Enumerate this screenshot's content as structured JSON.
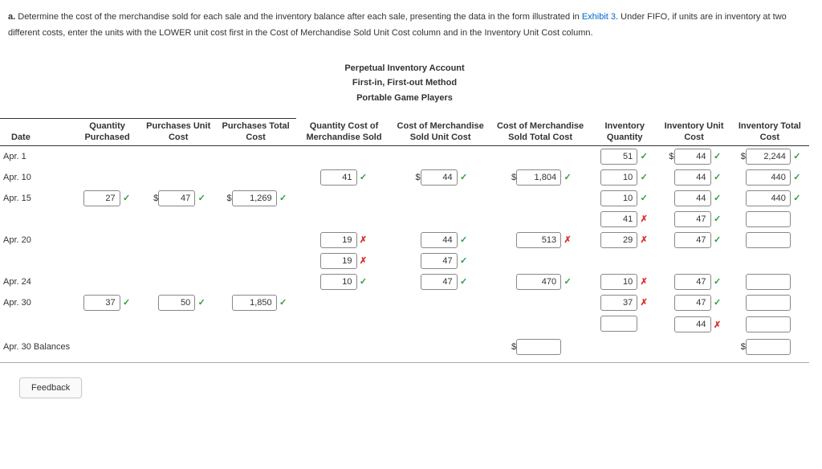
{
  "instr": {
    "label": "a.",
    "text1": " Determine the cost of the merchandise sold for each sale and the inventory balance after each sale, presenting the data in the form illustrated in ",
    "link": "Exhibit 3",
    "text2": ". Under FIFO, if units are in inventory at two different costs, enter the units with the LOWER unit cost first in the Cost of Merchandise Sold Unit Cost column and in the Inventory Unit Cost column."
  },
  "title": {
    "l1": "Perpetual Inventory Account",
    "l2": "First-in, First-out Method",
    "l3": "Portable Game Players"
  },
  "headers": {
    "date": "Date",
    "qp": "Quantity Purchased",
    "puc": "Purchases Unit Cost",
    "ptc": "Purchases Total Cost",
    "qcms": "Quantity Cost of Merchandise Sold",
    "cmsuc": "Cost of Merchandise Sold Unit Cost",
    "cmstc": "Cost of Merchandise Sold Total Cost",
    "iq": "Inventory Quantity",
    "iuc": "Inventory Unit Cost",
    "itc": "Inventory Total Cost"
  },
  "dates": {
    "r1": "Apr. 1",
    "r2": "Apr. 10",
    "r3": "Apr. 15",
    "r4": "",
    "r5": "Apr. 20",
    "r6": "",
    "r7": "Apr. 24",
    "r8": "Apr. 30",
    "r9": "",
    "r10": "Apr. 30  Balances"
  },
  "chart_data": {
    "type": "table",
    "columns": [
      "Date",
      "Quantity Purchased",
      "Purchases Unit Cost",
      "Purchases Total Cost",
      "Quantity COGS",
      "COGS Unit Cost",
      "COGS Total Cost",
      "Inventory Quantity",
      "Inventory Unit Cost",
      "Inventory Total Cost"
    ],
    "rows": [
      {
        "date": "Apr. 1",
        "iq": {
          "v": "51",
          "m": "ok"
        },
        "iuc": {
          "v": "44",
          "m": "ok",
          "d": true
        },
        "itc": {
          "v": "2,244",
          "m": "ok",
          "d": true
        }
      },
      {
        "date": "Apr. 10",
        "qs": {
          "v": "41",
          "m": "ok"
        },
        "suc": {
          "v": "44",
          "m": "ok",
          "d": true
        },
        "stc": {
          "v": "1,804",
          "m": "ok",
          "d": true
        },
        "iq": {
          "v": "10",
          "m": "ok"
        },
        "iuc": {
          "v": "44",
          "m": "ok"
        },
        "itc": {
          "v": "440",
          "m": "ok"
        }
      },
      {
        "date": "Apr. 15",
        "qp": {
          "v": "27",
          "m": "ok"
        },
        "puc": {
          "v": "47",
          "m": "ok",
          "d": true
        },
        "ptc": {
          "v": "1,269",
          "m": "ok",
          "d": true
        },
        "iq": {
          "v": "10",
          "m": "ok"
        },
        "iuc": {
          "v": "44",
          "m": "ok"
        },
        "itc": {
          "v": "440",
          "m": "ok"
        }
      },
      {
        "date": "",
        "iq": {
          "v": "41",
          "m": "bad"
        },
        "iuc": {
          "v": "47",
          "m": "ok"
        },
        "itc": {
          "v": "",
          "m": ""
        }
      },
      {
        "date": "Apr. 20",
        "qs": {
          "v": "19",
          "m": "bad"
        },
        "suc": {
          "v": "44",
          "m": "ok"
        },
        "stc": {
          "v": "513",
          "m": "bad"
        },
        "iq": {
          "v": "29",
          "m": "bad"
        },
        "iuc": {
          "v": "47",
          "m": "ok"
        },
        "itc": {
          "v": "",
          "m": ""
        }
      },
      {
        "date": "",
        "qs": {
          "v": "19",
          "m": "bad"
        },
        "suc": {
          "v": "47",
          "m": "ok"
        }
      },
      {
        "date": "Apr. 24",
        "qs": {
          "v": "10",
          "m": "ok"
        },
        "suc": {
          "v": "47",
          "m": "ok"
        },
        "stc": {
          "v": "470",
          "m": "ok"
        },
        "iq": {
          "v": "10",
          "m": "bad"
        },
        "iuc": {
          "v": "47",
          "m": "ok"
        },
        "itc": {
          "v": "",
          "m": ""
        }
      },
      {
        "date": "Apr. 30",
        "qp": {
          "v": "37",
          "m": "ok"
        },
        "puc": {
          "v": "50",
          "m": "ok"
        },
        "ptc": {
          "v": "1,850",
          "m": "ok"
        },
        "iq": {
          "v": "37",
          "m": "bad"
        },
        "iuc": {
          "v": "47",
          "m": "ok"
        },
        "itc": {
          "v": "",
          "m": ""
        }
      },
      {
        "date": "",
        "iq": {
          "v": "",
          "m": ""
        },
        "iuc": {
          "v": "44",
          "m": "bad"
        },
        "itc": {
          "v": "",
          "m": ""
        }
      },
      {
        "date": "Apr. 30  Balances",
        "stc": {
          "v": "",
          "m": "",
          "d": true
        },
        "itc": {
          "v": "",
          "m": "",
          "d": true
        }
      }
    ]
  },
  "feedback": "Feedback"
}
